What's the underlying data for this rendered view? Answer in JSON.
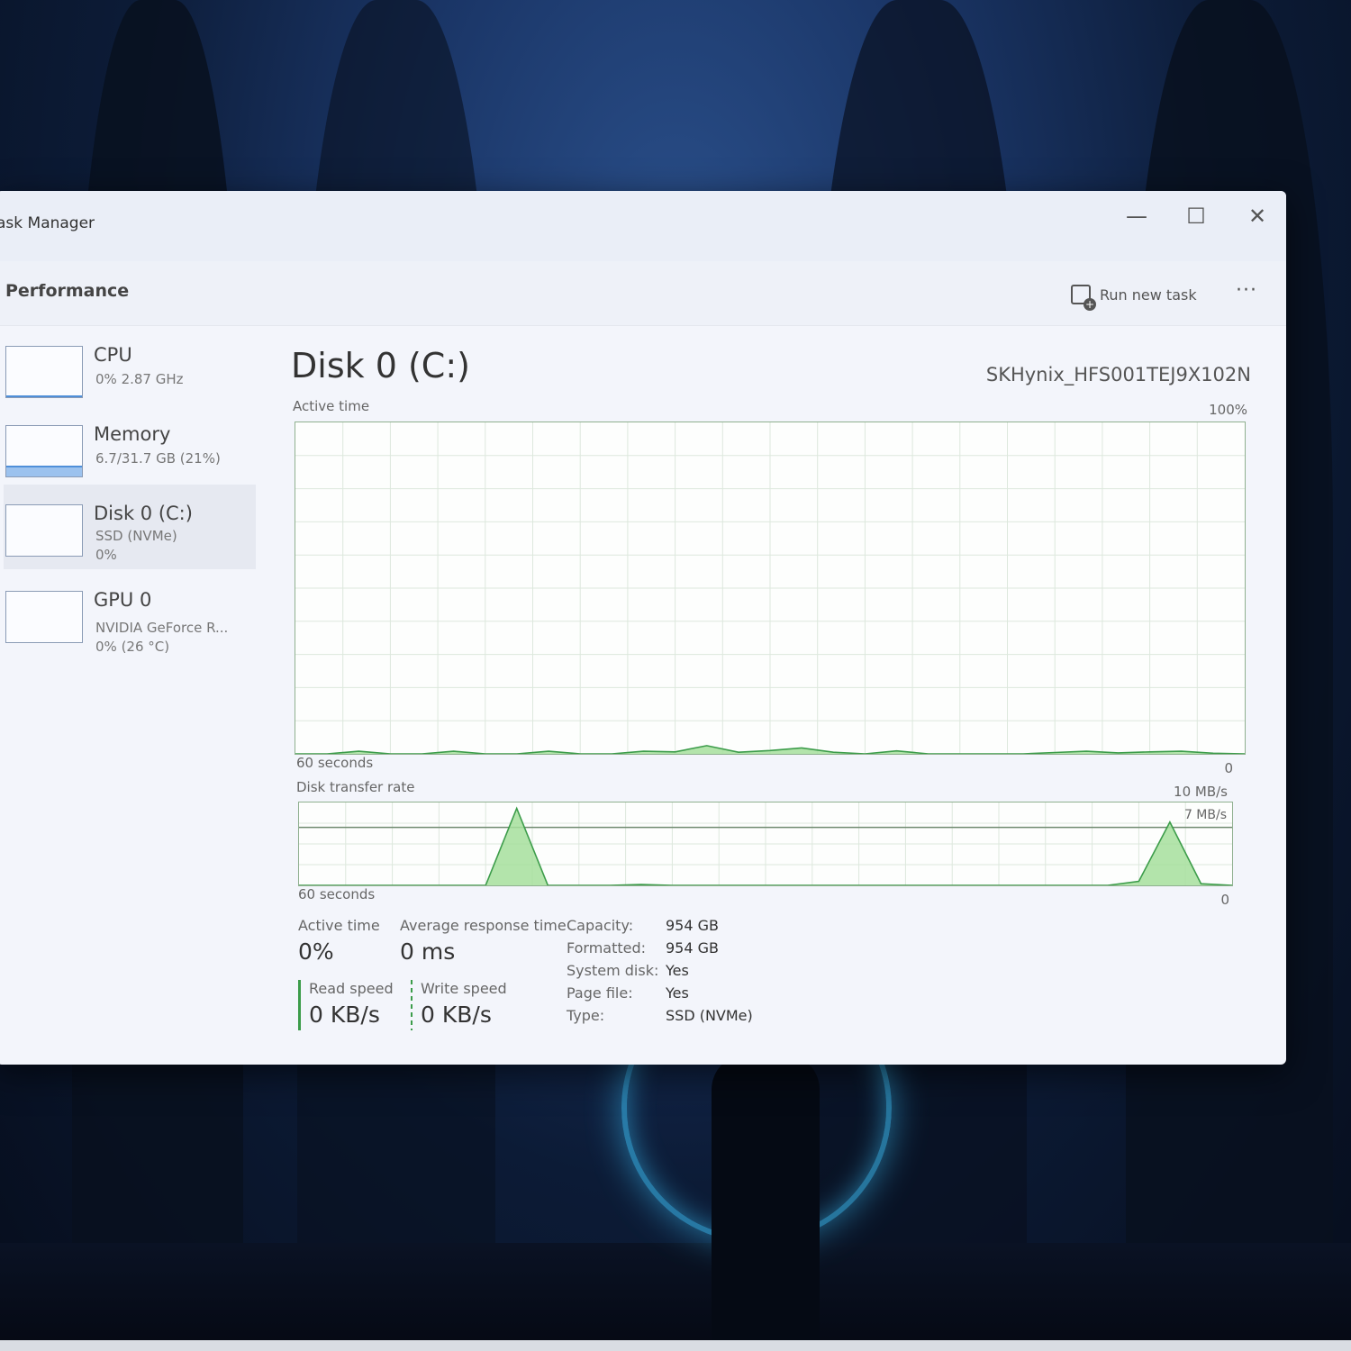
{
  "window": {
    "title": "ask Manager"
  },
  "header": {
    "page_title": "Performance",
    "run_task_label": "Run new task",
    "more_label": "···"
  },
  "controls": {
    "minimize": "—",
    "maximize": "☐",
    "close": "✕"
  },
  "sidebar": {
    "items": [
      {
        "name": "CPU",
        "sub1": "0%  2.87 GHz",
        "sub2": "",
        "level": 0.02
      },
      {
        "name": "Memory",
        "sub1": "6.7/31.7 GB (21%)",
        "sub2": "",
        "level": 0.21
      },
      {
        "name": "Disk 0 (C:)",
        "sub1": "SSD (NVMe)",
        "sub2": "0%",
        "level": 0.0
      },
      {
        "name": "GPU 0",
        "sub1": "NVIDIA GeForce R...",
        "sub2": "0%  (26 °C)",
        "level": 0.0
      }
    ]
  },
  "main": {
    "title": "Disk 0 (C:)",
    "model": "SKHynix_HFS001TEJ9X102N",
    "active_chart": {
      "label": "Active time",
      "max_label": "100%",
      "x_label": "60 seconds",
      "min_label": "0"
    },
    "transfer_chart": {
      "label": "Disk transfer rate",
      "max_label": "10 MB/s",
      "line_label": "7 MB/s",
      "x_label": "60 seconds",
      "min_label": "0"
    }
  },
  "stats": {
    "active_time_label": "Active time",
    "active_time_value": "0%",
    "response_label": "Average response time",
    "response_value": "0 ms",
    "read_label": "Read speed",
    "read_value": "0 KB/s",
    "write_label": "Write speed",
    "write_value": "0 KB/s"
  },
  "properties": [
    {
      "key": "Capacity:",
      "value": "954 GB"
    },
    {
      "key": "Formatted:",
      "value": "954 GB"
    },
    {
      "key": "System disk:",
      "value": "Yes"
    },
    {
      "key": "Page file:",
      "value": "Yes"
    },
    {
      "key": "Type:",
      "value": "SSD (NVMe)"
    }
  ],
  "chart_data": [
    {
      "type": "area",
      "title": "Active time",
      "xlabel": "60 seconds",
      "ylim": [
        0,
        100
      ],
      "x": [
        0,
        2,
        4,
        6,
        8,
        10,
        12,
        14,
        16,
        18,
        20,
        22,
        24,
        26,
        28,
        30,
        32,
        34,
        36,
        38,
        40,
        42,
        44,
        46,
        48,
        50,
        52,
        54,
        56,
        58,
        60
      ],
      "series": [
        {
          "values": [
            0,
            0,
            0.8,
            0,
            0,
            0.8,
            0,
            0,
            0.8,
            0,
            0,
            0.8,
            0.6,
            2.5,
            0.5,
            1,
            1.8,
            0.5,
            0,
            0.9,
            0,
            0,
            0,
            0,
            0.4,
            0.8,
            0.3,
            0.6,
            0.8,
            0.2,
            0
          ]
        }
      ]
    },
    {
      "type": "area",
      "title": "Disk transfer rate",
      "xlabel": "60 seconds",
      "ylim": [
        0,
        10
      ],
      "x": [
        0,
        2,
        4,
        6,
        8,
        10,
        12,
        14,
        16,
        18,
        20,
        22,
        24,
        26,
        28,
        30,
        32,
        34,
        36,
        38,
        40,
        42,
        44,
        46,
        48,
        50,
        52,
        54,
        56,
        58,
        60
      ],
      "series": [
        {
          "values": [
            0,
            0,
            0,
            0,
            0,
            0,
            0,
            9.5,
            0,
            0,
            0,
            0.1,
            0,
            0,
            0,
            0,
            0,
            0,
            0,
            0,
            0,
            0,
            0,
            0,
            0,
            0,
            0,
            0.5,
            7.8,
            0.2,
            0
          ]
        }
      ]
    }
  ],
  "colors": {
    "graph_line": "#3c9c4a",
    "graph_fill": "#a6df9c",
    "grid": "#dde8dd",
    "accent": "#4f8fd9"
  }
}
